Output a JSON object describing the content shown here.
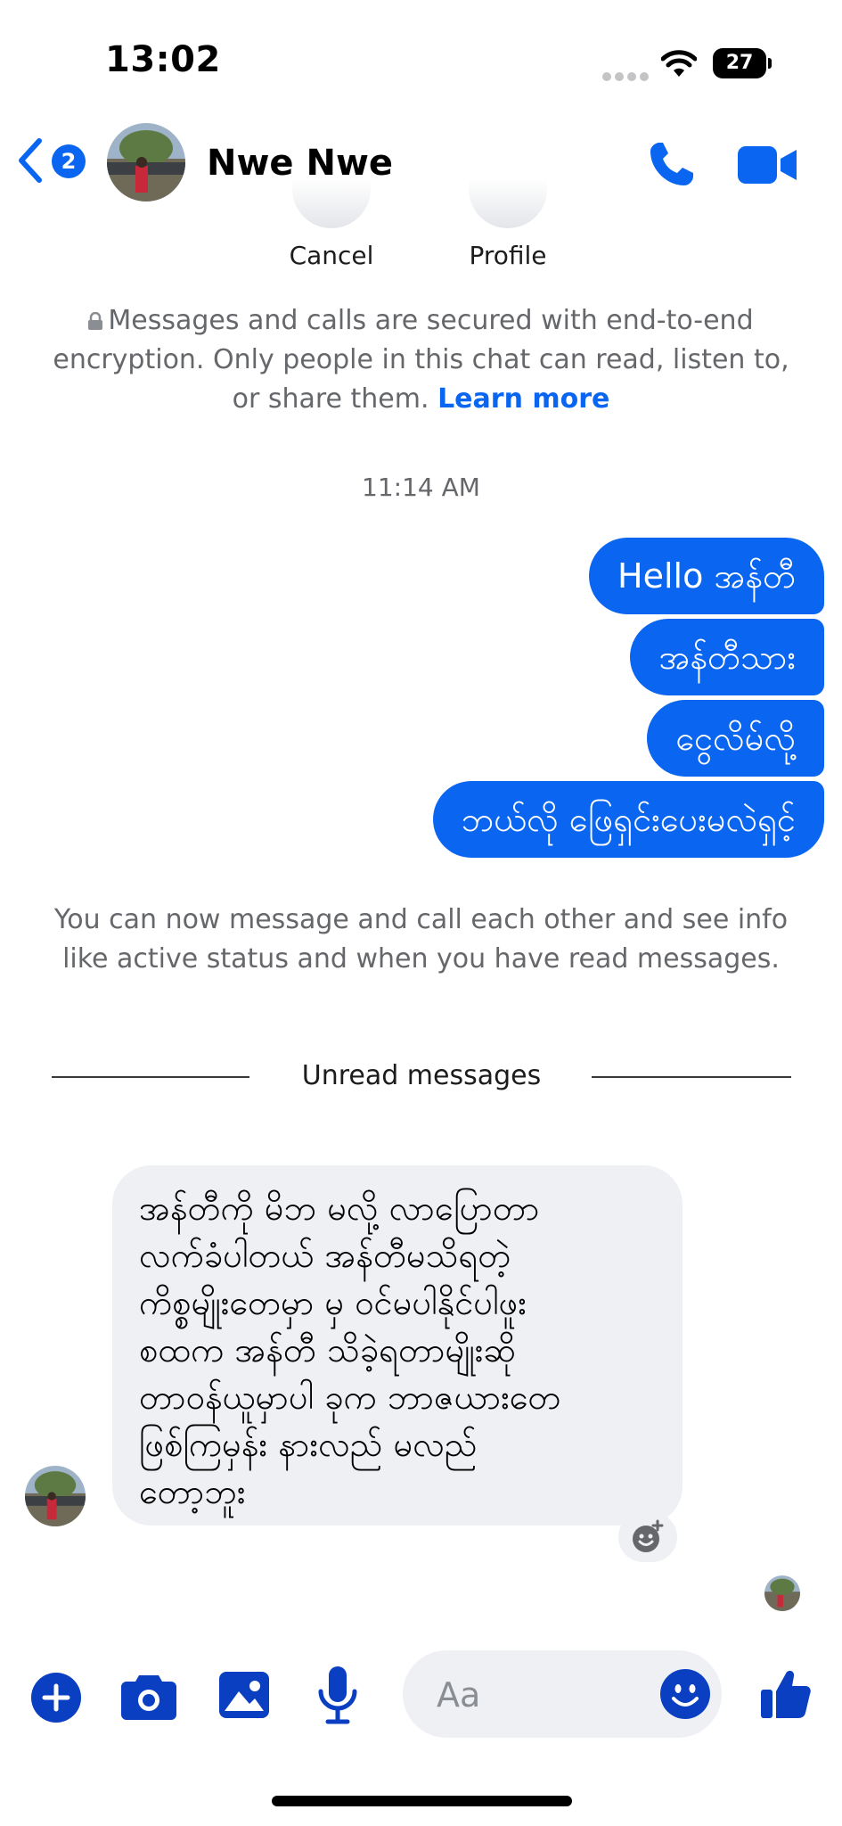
{
  "status_bar": {
    "time": "13:02",
    "battery": "27"
  },
  "header": {
    "back_badge": "2",
    "contact_name": "Nwe Nwe"
  },
  "profile_actions": {
    "cancel_label": "Cancel",
    "profile_label": "Profile"
  },
  "encryption": {
    "text": "Messages and calls are secured with end-to-end encryption. Only people in this chat can read, listen to, or share them.",
    "link": "Learn more"
  },
  "timestamp": "11:14 AM",
  "outgoing_messages": [
    "Hello အန်တီ",
    "အန်တီသား",
    "ငွေလိမ်လို့",
    "ဘယ်လို ဖြေရှင်းပေးမလဲရှင့်"
  ],
  "info_note": "You can now message and call each other and see info like active status and when you have read messages.",
  "unread_label": "Unread messages",
  "incoming_message": "အန်တီကို မိဘ မလို့ လာပြောတာ\nလက်ခံပါတယ် အန်တီမသိရတဲ့\nကိစ္စမျိုးတေမှာ မှ ဝင်မပါနိုင်ပါဖူး\nစထက အန်တီ သိခဲ့ရတာမျိုးဆို\nတာဝန်ယူမှာပါ ခုက ဘာဇယားတေ\nဖြစ်ကြမှန်း နားလည် မလည်\nတော့ဘူး",
  "composer": {
    "placeholder": "Aa"
  },
  "colors": {
    "accent": "#0a66f0",
    "bubble_in": "#eef0f4",
    "muted_text": "#65676b"
  }
}
